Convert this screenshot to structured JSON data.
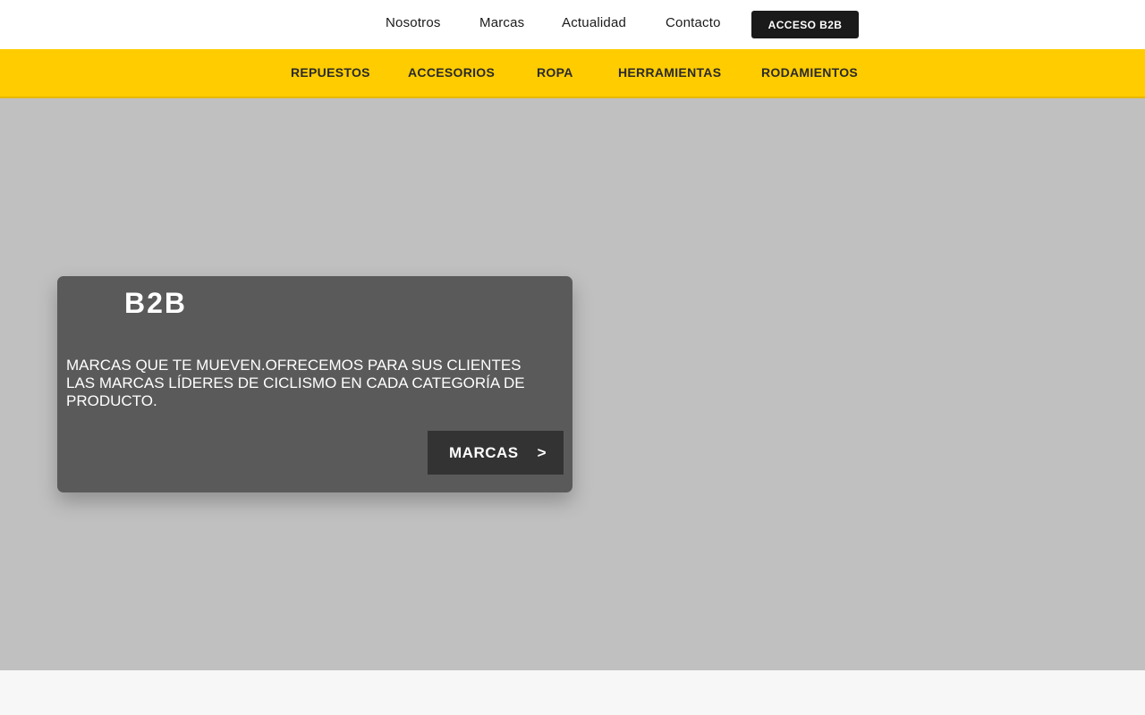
{
  "top_nav": {
    "links": [
      "Nosotros",
      "Marcas",
      "Actualidad",
      "Contacto"
    ],
    "b2b_button": "ACCESO B2B"
  },
  "category_nav": {
    "links": [
      "REPUESTOS",
      "ACCESORIOS",
      "ROPA",
      "HERRAMIENTAS",
      "RODAMIENTOS"
    ]
  },
  "hero_card": {
    "title": "B2B",
    "text": "MARCAS QUE TE MUEVEN.OFRECEMOS PARA SUS CLIENTES LAS MARCAS LÍDERES DE CICLISMO EN CADA CATEGORÍA DE PRODUCTO.",
    "button_label": "MARCAS",
    "button_arrow": ">"
  },
  "colors": {
    "accent_yellow": "#ffcc00",
    "dark": "#1a1a1a",
    "hero_bg": "#c0c0c0",
    "card_bg": "#5a5a5a"
  }
}
